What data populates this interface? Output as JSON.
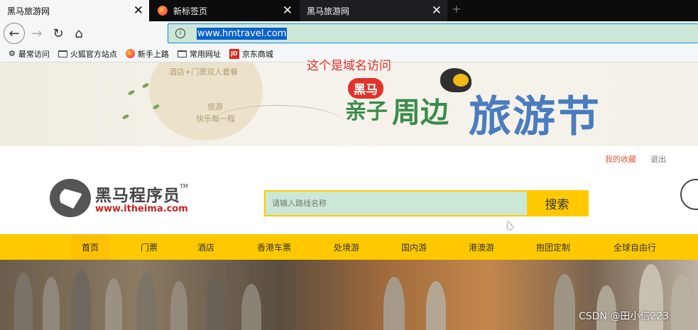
{
  "browser": {
    "tabs": [
      {
        "label": "黑马旅游网",
        "active": true
      },
      {
        "label": "新标签页",
        "active": false
      },
      {
        "label": "黑马旅游网",
        "active": false
      }
    ],
    "close_glyph": "✕",
    "new_tab_glyph": "+",
    "url": "www.hmtravel.com",
    "bookmarks": [
      {
        "label": "最常访问",
        "icon": "gear-icon"
      },
      {
        "label": "火狐官方站点",
        "icon": "folder-icon"
      },
      {
        "label": "新手上路",
        "icon": "firefox-icon"
      },
      {
        "label": "常用网址",
        "icon": "folder-icon"
      },
      {
        "label": "京东商城",
        "icon": "jd-icon"
      }
    ],
    "jd_glyph": "JD"
  },
  "annotation": "这个是域名访问",
  "banner": {
    "promo_line": "酒店+门票双人套餐",
    "tag1": "旅游",
    "tag2": "快乐每一程",
    "brand": "黑马",
    "slogan_a": "亲子",
    "slogan_b": "周边",
    "slogan_c": "旅游节"
  },
  "header": {
    "favorites": "我的收藏",
    "logout": "退出",
    "logo_text": "黑马程序员",
    "logo_tm": "TM",
    "logo_url": "www.itheima.com",
    "search_placeholder": "请输入路线名称",
    "search_button": "搜索"
  },
  "menu": [
    "首页",
    "门票",
    "酒店",
    "香港车票",
    "处境游",
    "国内游",
    "港澳游",
    "抱团定制",
    "全球自由行"
  ],
  "watermark": "CSDN @田小信223"
}
